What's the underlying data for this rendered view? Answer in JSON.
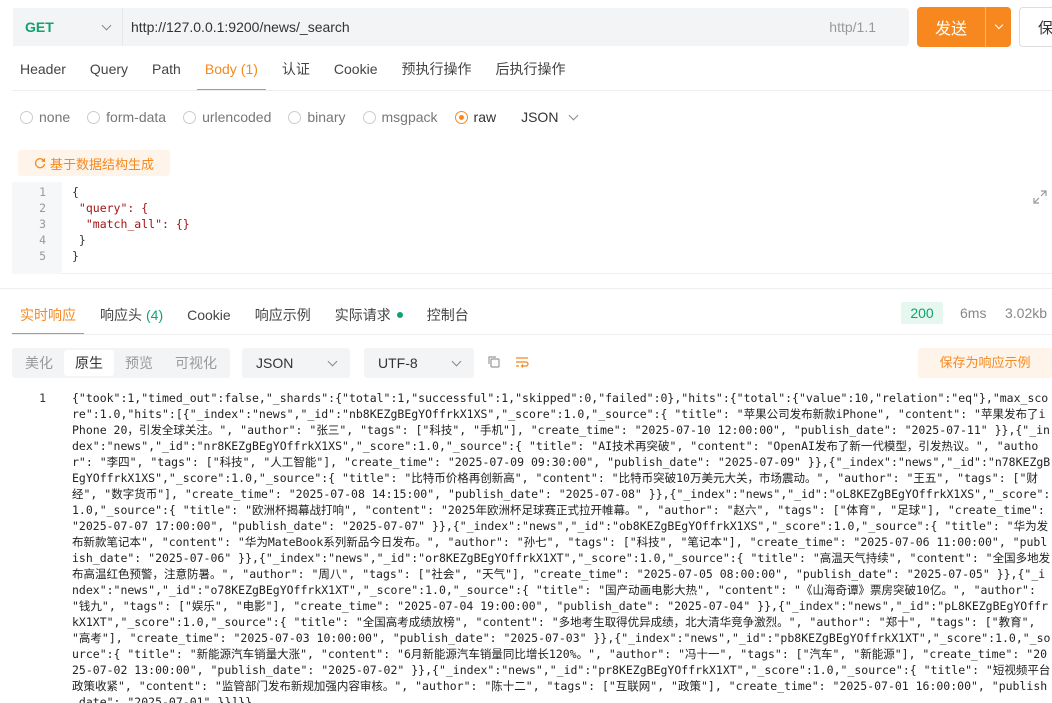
{
  "request": {
    "method": "GET",
    "url": "http://127.0.0.1:9200/news/_search",
    "http_version": "http/1.1",
    "send_label": "发送",
    "save_label": "保"
  },
  "req_tabs": [
    {
      "label": "Header",
      "count": ""
    },
    {
      "label": "Query",
      "count": ""
    },
    {
      "label": "Path",
      "count": ""
    },
    {
      "label": "Body",
      "count": "(1)"
    },
    {
      "label": "认证",
      "count": ""
    },
    {
      "label": "Cookie",
      "count": ""
    },
    {
      "label": "预执行操作",
      "count": ""
    },
    {
      "label": "后执行操作",
      "count": ""
    }
  ],
  "body_types": [
    {
      "label": "none",
      "checked": false
    },
    {
      "label": "form-data",
      "checked": false
    },
    {
      "label": "urlencoded",
      "checked": false
    },
    {
      "label": "binary",
      "checked": false
    },
    {
      "label": "msgpack",
      "checked": false
    },
    {
      "label": "raw",
      "checked": true
    }
  ],
  "raw_format": "JSON",
  "generate_label": "基于数据结构生成",
  "editor_lines": [
    {
      "n": "1",
      "text": "{"
    },
    {
      "n": "2",
      "text": " \"query\": {"
    },
    {
      "n": "3",
      "text": "  \"match_all\": {}"
    },
    {
      "n": "4",
      "text": " }"
    },
    {
      "n": "5",
      "text": "}"
    }
  ],
  "resp_tabs": [
    {
      "label": "实时响应",
      "count": ""
    },
    {
      "label": "响应头",
      "count": "(4)"
    },
    {
      "label": "Cookie",
      "count": ""
    },
    {
      "label": "响应示例",
      "count": ""
    },
    {
      "label": "实际请求",
      "count": ""
    },
    {
      "label": "控制台",
      "count": ""
    }
  ],
  "status_code": "200",
  "elapsed": "6ms",
  "resp_size": "3.02kb",
  "view_modes": [
    "美化",
    "原生",
    "预览",
    "可视化"
  ],
  "view_mode_active": "原生",
  "resp_format": "JSON",
  "encoding": "UTF-8",
  "save_example_label": "保存为响应示例",
  "response_line_no": "1",
  "response_raw": "{\"took\":1,\"timed_out\":false,\"_shards\":{\"total\":1,\"successful\":1,\"skipped\":0,\"failed\":0},\"hits\":{\"total\":{\"value\":10,\"relation\":\"eq\"},\"max_score\":1.0,\"hits\":[{\"_index\":\"news\",\"_id\":\"nb8KEZgBEgYOffrkX1XS\",\"_score\":1.0,\"_source\":{ \"title\": \"苹果公司发布新款iPhone\", \"content\": \"苹果发布了iPhone 20，引发全球关注。\", \"author\": \"张三\", \"tags\": [\"科技\", \"手机\"], \"create_time\": \"2025-07-10 12:00:00\", \"publish_date\": \"2025-07-11\" }},{\"_index\":\"news\",\"_id\":\"nr8KEZgBEgYOffrkX1XS\",\"_score\":1.0,\"_source\":{ \"title\": \"AI技术再突破\", \"content\": \"OpenAI发布了新一代模型，引发热议。\", \"author\": \"李四\", \"tags\": [\"科技\", \"人工智能\"], \"create_time\": \"2025-07-09 09:30:00\", \"publish_date\": \"2025-07-09\" }},{\"_index\":\"news\",\"_id\":\"n78KEZgBEgYOffrkX1XS\",\"_score\":1.0,\"_source\":{ \"title\": \"比特币价格再创新高\", \"content\": \"比特币突破10万美元大关，市场震动。\", \"author\": \"王五\", \"tags\": [\"财经\", \"数字货币\"], \"create_time\": \"2025-07-08 14:15:00\", \"publish_date\": \"2025-07-08\" }},{\"_index\":\"news\",\"_id\":\"oL8KEZgBEgYOffrkX1XS\",\"_score\":1.0,\"_source\":{ \"title\": \"欧洲杯揭幕战打响\", \"content\": \"2025年欧洲杯足球赛正式拉开帷幕。\", \"author\": \"赵六\", \"tags\": [\"体育\", \"足球\"], \"create_time\": \"2025-07-07 17:00:00\", \"publish_date\": \"2025-07-07\" }},{\"_index\":\"news\",\"_id\":\"ob8KEZgBEgYOffrkX1XS\",\"_score\":1.0,\"_source\":{ \"title\": \"华为发布新款笔记本\", \"content\": \"华为MateBook系列新品今日发布。\", \"author\": \"孙七\", \"tags\": [\"科技\", \"笔记本\"], \"create_time\": \"2025-07-06 11:00:00\", \"publish_date\": \"2025-07-06\" }},{\"_index\":\"news\",\"_id\":\"or8KEZgBEgYOffrkX1XT\",\"_score\":1.0,\"_source\":{ \"title\": \"高温天气持续\", \"content\": \"全国多地发布高温红色预警，注意防暑。\", \"author\": \"周八\", \"tags\": [\"社会\", \"天气\"], \"create_time\": \"2025-07-05 08:00:00\", \"publish_date\": \"2025-07-05\" }},{\"_index\":\"news\",\"_id\":\"o78KEZgBEgYOffrkX1XT\",\"_score\":1.0,\"_source\":{ \"title\": \"国产动画电影大热\", \"content\": \"《山海奇谭》票房突破10亿。\", \"author\": \"钱九\", \"tags\": [\"娱乐\", \"电影\"], \"create_time\": \"2025-07-04 19:00:00\", \"publish_date\": \"2025-07-04\" }},{\"_index\":\"news\",\"_id\":\"pL8KEZgBEgYOffrkX1XT\",\"_score\":1.0,\"_source\":{ \"title\": \"全国高考成绩放榜\", \"content\": \"多地考生取得优异成绩，北大清华竞争激烈。\", \"author\": \"郑十\", \"tags\": [\"教育\", \"高考\"], \"create_time\": \"2025-07-03 10:00:00\", \"publish_date\": \"2025-07-03\" }},{\"_index\":\"news\",\"_id\":\"pb8KEZgBEgYOffrkX1XT\",\"_score\":1.0,\"_source\":{ \"title\": \"新能源汽车销量大涨\", \"content\": \"6月新能源汽车销量同比增长120%。\", \"author\": \"冯十一\", \"tags\": [\"汽车\", \"新能源\"], \"create_time\": \"2025-07-02 13:00:00\", \"publish_date\": \"2025-07-02\" }},{\"_index\":\"news\",\"_id\":\"pr8KEZgBEgYOffrkX1XT\",\"_score\":1.0,\"_source\":{ \"title\": \"短视频平台政策收紧\", \"content\": \"监管部门发布新规加强内容审核。\", \"author\": \"陈十二\", \"tags\": [\"互联网\", \"政策\"], \"create_time\": \"2025-07-01 16:00:00\", \"publish_date\": \"2025-07-01\" }}]}}",
  "colors": {
    "accent": "#f6881f",
    "success": "#10a36d"
  },
  "icons": [
    "chevron-down-icon",
    "refresh-icon",
    "expand-icon",
    "copy-icon",
    "wrap-icon"
  ]
}
